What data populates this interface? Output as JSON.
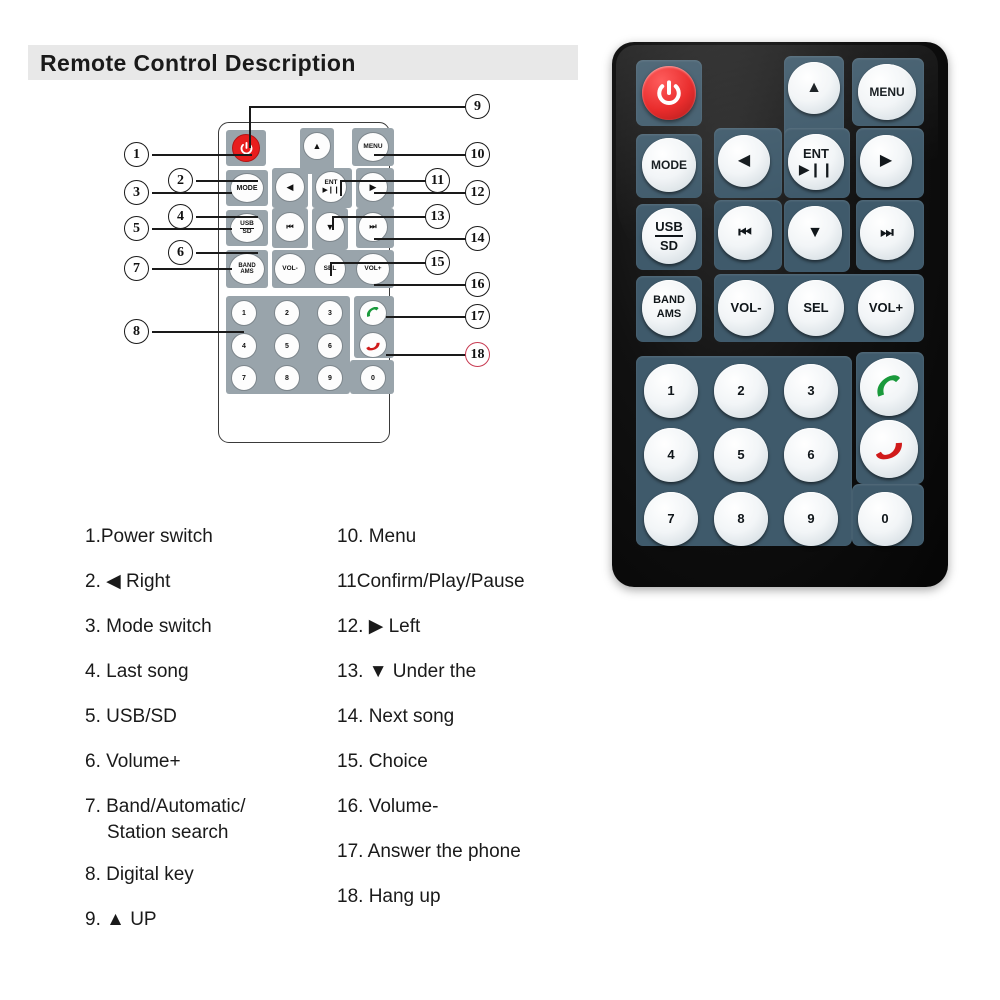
{
  "header": {
    "title": "Remote Control Description"
  },
  "diagram": {
    "name": "remote-control-line-diagram",
    "buttons": {
      "power": "",
      "mode": "MODE",
      "usb_sd_line1": "USB",
      "usb_sd_line2": "SD",
      "band_line1": "BAND",
      "band_line2": "AMS",
      "menu": "MENU",
      "ent_line1": "ENT",
      "ent_line2": "▶❙❙",
      "up": "▲",
      "down": "▼",
      "left": "◀",
      "right": "▶",
      "prev": "⏮",
      "next": "⏭",
      "vol_minus": "VOL-",
      "sel": "SEL",
      "vol_plus": "VOL+",
      "call_answer": "answer-call",
      "call_end": "end-call",
      "keypad": [
        "1",
        "2",
        "3",
        "4",
        "5",
        "6",
        "7",
        "8",
        "9",
        "0"
      ]
    },
    "callouts": [
      {
        "n": "1"
      },
      {
        "n": "2"
      },
      {
        "n": "3"
      },
      {
        "n": "4"
      },
      {
        "n": "5"
      },
      {
        "n": "6"
      },
      {
        "n": "7"
      },
      {
        "n": "8"
      },
      {
        "n": "9"
      },
      {
        "n": "10"
      },
      {
        "n": "11"
      },
      {
        "n": "12"
      },
      {
        "n": "13"
      },
      {
        "n": "14"
      },
      {
        "n": "15"
      },
      {
        "n": "16"
      },
      {
        "n": "17"
      },
      {
        "n": "18"
      }
    ],
    "callout_18_color": "#c83b52"
  },
  "descriptions": {
    "left_column": [
      "1.Power switch",
      "2. ◀ Right",
      "3. Mode switch",
      "4. Last song",
      "5. USB/SD",
      "6. Volume+",
      "7. Band/Automatic/",
      "Station search",
      "8. Digital key",
      "9. ▲ UP"
    ],
    "right_column": [
      "10. Menu",
      "11Confirm/Play/Pause",
      "12. ▶  Left",
      "13. ▼  Under the",
      "14. Next song",
      "15. Choice",
      "16. Volume-",
      "17. Answer the phone",
      "18. Hang up"
    ]
  },
  "photo": {
    "name": "remote-control-product-photo",
    "buttons": {
      "power": "power-icon",
      "up": "▲",
      "menu": "MENU",
      "mode": "MODE",
      "left": "◀",
      "ent_line1": "ENT",
      "ent_line2": "▶❙❙",
      "right": "▶",
      "usb_line1": "USB",
      "usb_line2": "SD",
      "prev": "⏮",
      "down": "▼",
      "next": "⏭",
      "band_line1": "BAND",
      "band_line2": "AMS",
      "vol_minus": "VOL-",
      "sel": "SEL",
      "vol_plus": "VOL+",
      "keypad": [
        "1",
        "2",
        "3",
        "4",
        "5",
        "6",
        "7",
        "8",
        "9",
        "0"
      ],
      "call_answer": "answer-call",
      "call_end": "end-call"
    }
  },
  "colors": {
    "header_bg": "#e8e8e8",
    "diagram_panel": "#99a4ab",
    "photo_body": "#111111",
    "photo_panel": "#3f5a6b",
    "power_red": "#e81d1d",
    "answer_green": "#1a9a3c",
    "end_red": "#d01a1a",
    "callout_red": "#c83b52"
  }
}
